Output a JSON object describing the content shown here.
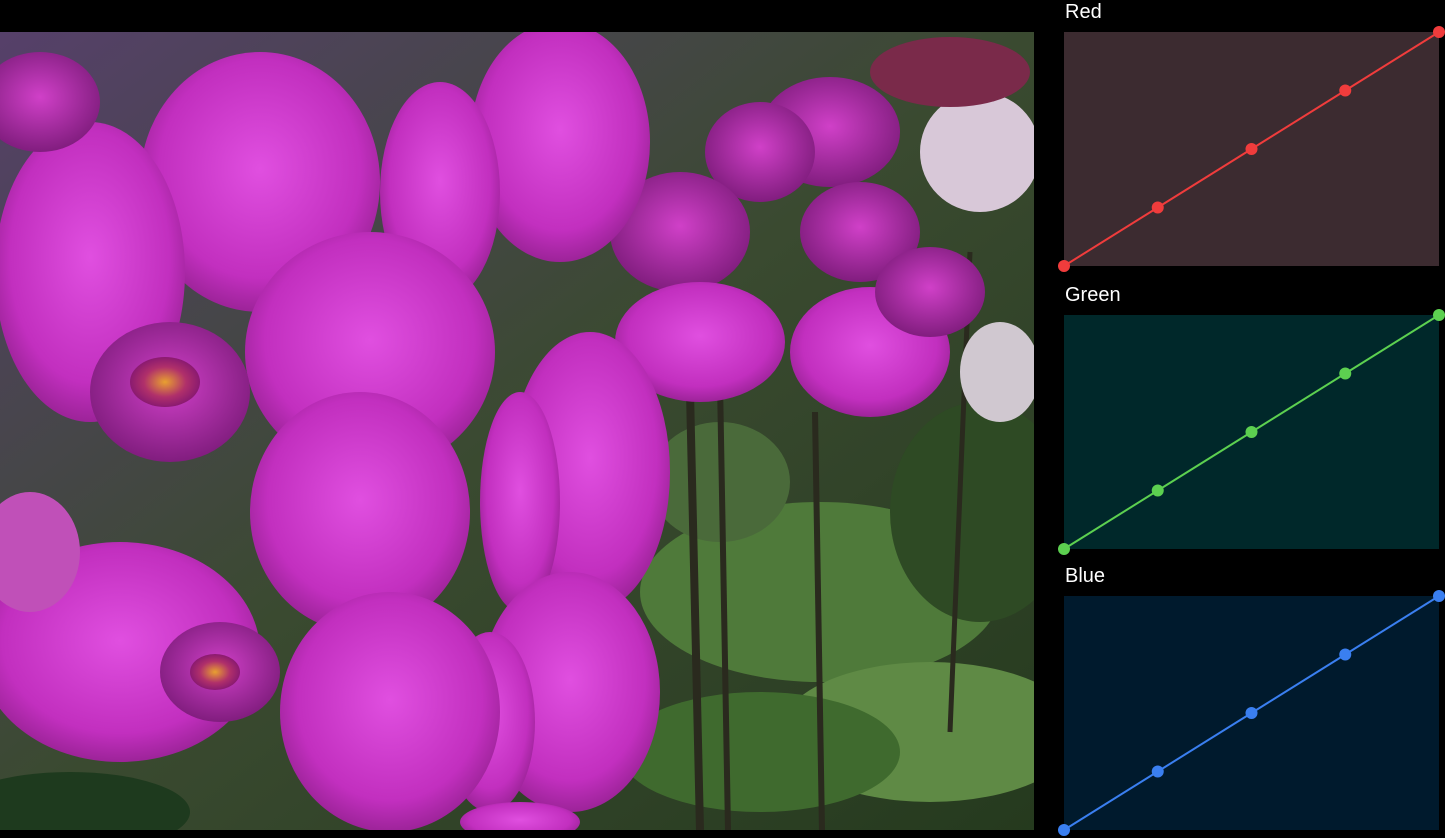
{
  "photo": {
    "subject": "magenta-orchid-photo"
  },
  "curves": [
    {
      "id": "red",
      "label": "Red",
      "panel_color": "#3c2b30",
      "line_color": "#f03c3c",
      "points": [
        [
          0,
          0
        ],
        [
          0.25,
          0.25
        ],
        [
          0.5,
          0.5
        ],
        [
          0.75,
          0.75
        ],
        [
          1,
          1
        ]
      ]
    },
    {
      "id": "green",
      "label": "Green",
      "panel_color": "#00282a",
      "line_color": "#5cd050",
      "points": [
        [
          0,
          0
        ],
        [
          0.25,
          0.25
        ],
        [
          0.5,
          0.5
        ],
        [
          0.75,
          0.75
        ],
        [
          1,
          1
        ]
      ]
    },
    {
      "id": "blue",
      "label": "Blue",
      "panel_color": "#001a2d",
      "line_color": "#3a7ff0",
      "points": [
        [
          0,
          0
        ],
        [
          0.25,
          0.25
        ],
        [
          0.5,
          0.5
        ],
        [
          0.75,
          0.75
        ],
        [
          1,
          1
        ]
      ]
    }
  ]
}
